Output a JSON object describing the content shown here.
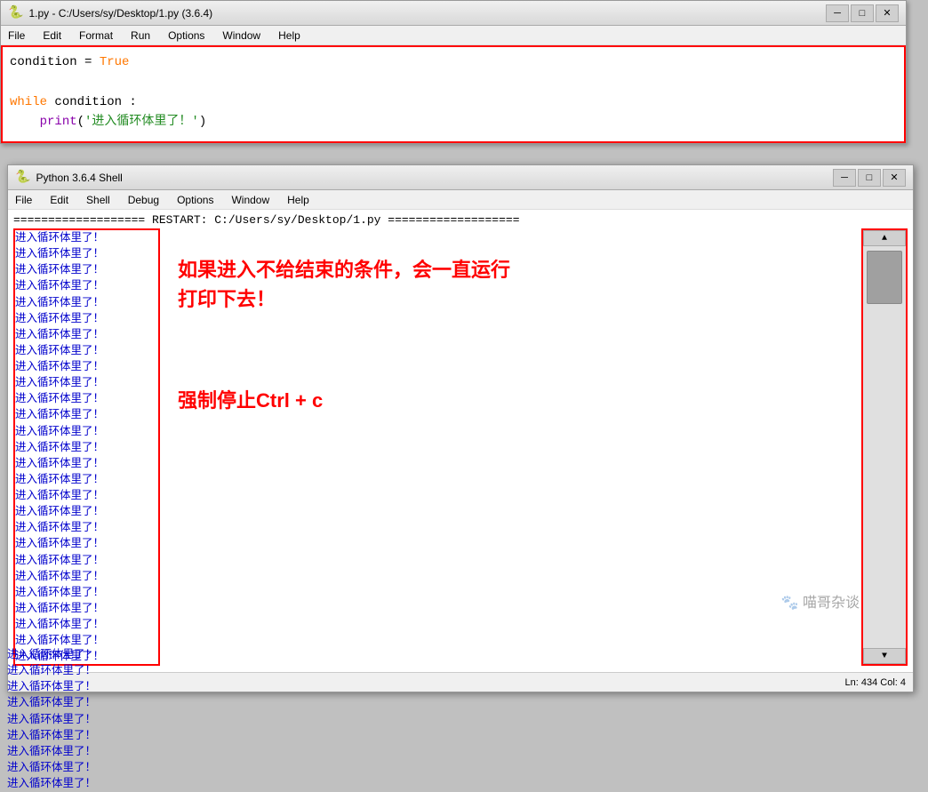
{
  "editor": {
    "title": "1.py - C:/Users/sy/Desktop/1.py (3.6.4)",
    "icon": "🐍",
    "menu": [
      "File",
      "Edit",
      "Format",
      "Run",
      "Options",
      "Window",
      "Help"
    ],
    "code_lines": [
      {
        "text": "condition = True",
        "parts": [
          {
            "t": "condition = ",
            "c": "normal"
          },
          {
            "t": "True",
            "c": "orange"
          }
        ]
      },
      {
        "text": ""
      },
      {
        "text": "while condition :",
        "parts": [
          {
            "t": "while",
            "c": "orange"
          },
          {
            "t": " condition :",
            "c": "normal"
          }
        ]
      },
      {
        "text": "    print('进入循环体里了！')",
        "parts": [
          {
            "t": "    print(",
            "c": "purple"
          },
          {
            "t": "'进入循环体里了！'",
            "c": "green"
          },
          {
            "t": ")",
            "c": "purple"
          }
        ]
      }
    ]
  },
  "shell": {
    "title": "Python 3.6.4 Shell",
    "icon": "🐍",
    "menu": [
      "File",
      "Edit",
      "Shell",
      "Debug",
      "Options",
      "Window",
      "Help"
    ],
    "restart_line": "=================== RESTART: C:/Users/sy/Desktop/1.py ===================",
    "output_line": "进入循环体里了！",
    "output_count": 30,
    "annotation1": "如果进入不给结束的条件，会一直运行\n打印下去！",
    "annotation2": "强制停止Ctrl + c",
    "status": "Ln: 434  Col: 4"
  },
  "watermark": "喵哥杂谈",
  "titlebar_controls": {
    "minimize": "─",
    "maximize": "□",
    "close": "✕"
  }
}
